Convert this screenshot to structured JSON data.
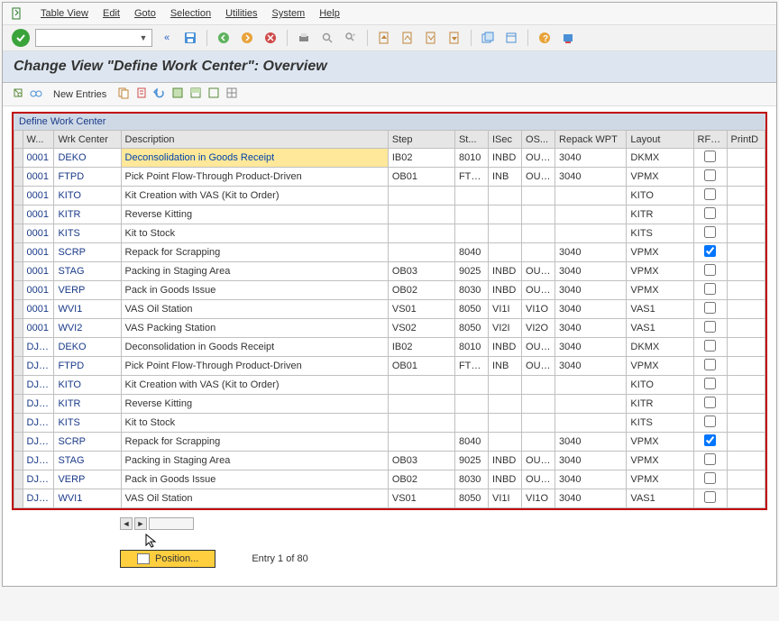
{
  "menubar": {
    "items": [
      "Table View",
      "Edit",
      "Goto",
      "Selection",
      "Utilities",
      "System",
      "Help"
    ]
  },
  "heading": "Change View \"Define Work Center\": Overview",
  "subToolbar": {
    "newEntries": "New Entries"
  },
  "table": {
    "title": "Define Work Center",
    "headers": {
      "whno": "W...",
      "wrkCenter": "Wrk Center",
      "description": "Description",
      "step": "Step",
      "stor": "St...",
      "isec": "ISec",
      "osec": "OS...",
      "repack": "Repack WPT",
      "layout": "Layout",
      "rfhu": "RF: HU",
      "printd": "PrintD"
    },
    "rows": [
      {
        "whno": "0001",
        "wc": "DEKO",
        "desc": "Deconsolidation in Goods Receipt",
        "step": "IB02",
        "stor": "8010",
        "isec": "INBD",
        "osec": "OUTB",
        "rwpt": "3040",
        "lay": "DKMX",
        "rfhu": false,
        "selected": true
      },
      {
        "whno": "0001",
        "wc": "FTPD",
        "desc": "Pick Point Flow-Through Product-Driven",
        "step": "OB01",
        "stor": "FTPD",
        "isec": "INB",
        "osec": "OUTB",
        "rwpt": "3040",
        "lay": "VPMX",
        "rfhu": false
      },
      {
        "whno": "0001",
        "wc": "KITO",
        "desc": "Kit Creation with VAS (Kit to Order)",
        "step": "",
        "stor": "",
        "isec": "",
        "osec": "",
        "rwpt": "",
        "lay": "KITO",
        "rfhu": false
      },
      {
        "whno": "0001",
        "wc": "KITR",
        "desc": "Reverse Kitting",
        "step": "",
        "stor": "",
        "isec": "",
        "osec": "",
        "rwpt": "",
        "lay": "KITR",
        "rfhu": false
      },
      {
        "whno": "0001",
        "wc": "KITS",
        "desc": "Kit to Stock",
        "step": "",
        "stor": "",
        "isec": "",
        "osec": "",
        "rwpt": "",
        "lay": "KITS",
        "rfhu": false
      },
      {
        "whno": "0001",
        "wc": "SCRP",
        "desc": "Repack for Scrapping",
        "step": "",
        "stor": "8040",
        "isec": "",
        "osec": "",
        "rwpt": "3040",
        "lay": "VPMX",
        "rfhu": true
      },
      {
        "whno": "0001",
        "wc": "STAG",
        "desc": "Packing in Staging Area",
        "step": "OB03",
        "stor": "9025",
        "isec": "INBD",
        "osec": "OUTB",
        "rwpt": "3040",
        "lay": "VPMX",
        "rfhu": false
      },
      {
        "whno": "0001",
        "wc": "VERP",
        "desc": "Pack in Goods Issue",
        "step": "OB02",
        "stor": "8030",
        "isec": "INBD",
        "osec": "OUTB",
        "rwpt": "3040",
        "lay": "VPMX",
        "rfhu": false
      },
      {
        "whno": "0001",
        "wc": "WVI1",
        "desc": "VAS Oil Station",
        "step": "VS01",
        "stor": "8050",
        "isec": "VI1I",
        "osec": "VI1O",
        "rwpt": "3040",
        "lay": "VAS1",
        "rfhu": false
      },
      {
        "whno": "0001",
        "wc": "WVI2",
        "desc": "VAS Packing Station",
        "step": "VS02",
        "stor": "8050",
        "isec": "VI2I",
        "osec": "VI2O",
        "rwpt": "3040",
        "lay": "VAS1",
        "rfhu": false
      },
      {
        "whno": "DJPL",
        "wc": "DEKO",
        "desc": "Deconsolidation in Goods Receipt",
        "step": "IB02",
        "stor": "8010",
        "isec": "INBD",
        "osec": "OUTB",
        "rwpt": "3040",
        "lay": "DKMX",
        "rfhu": false
      },
      {
        "whno": "DJPL",
        "wc": "FTPD",
        "desc": "Pick Point Flow-Through Product-Driven",
        "step": "OB01",
        "stor": "FTPD",
        "isec": "INB",
        "osec": "OUTB",
        "rwpt": "3040",
        "lay": "VPMX",
        "rfhu": false
      },
      {
        "whno": "DJPL",
        "wc": "KITO",
        "desc": "Kit Creation with VAS (Kit to Order)",
        "step": "",
        "stor": "",
        "isec": "",
        "osec": "",
        "rwpt": "",
        "lay": "KITO",
        "rfhu": false
      },
      {
        "whno": "DJPL",
        "wc": "KITR",
        "desc": "Reverse Kitting",
        "step": "",
        "stor": "",
        "isec": "",
        "osec": "",
        "rwpt": "",
        "lay": "KITR",
        "rfhu": false
      },
      {
        "whno": "DJPL",
        "wc": "KITS",
        "desc": "Kit to Stock",
        "step": "",
        "stor": "",
        "isec": "",
        "osec": "",
        "rwpt": "",
        "lay": "KITS",
        "rfhu": false
      },
      {
        "whno": "DJPL",
        "wc": "SCRP",
        "desc": "Repack for Scrapping",
        "step": "",
        "stor": "8040",
        "isec": "",
        "osec": "",
        "rwpt": "3040",
        "lay": "VPMX",
        "rfhu": true
      },
      {
        "whno": "DJPL",
        "wc": "STAG",
        "desc": "Packing in Staging Area",
        "step": "OB03",
        "stor": "9025",
        "isec": "INBD",
        "osec": "OUTB",
        "rwpt": "3040",
        "lay": "VPMX",
        "rfhu": false
      },
      {
        "whno": "DJPL",
        "wc": "VERP",
        "desc": "Pack in Goods Issue",
        "step": "OB02",
        "stor": "8030",
        "isec": "INBD",
        "osec": "OUTB",
        "rwpt": "3040",
        "lay": "VPMX",
        "rfhu": false
      },
      {
        "whno": "DJPL",
        "wc": "WVI1",
        "desc": "VAS Oil Station",
        "step": "VS01",
        "stor": "8050",
        "isec": "VI1I",
        "osec": "VI1O",
        "rwpt": "3040",
        "lay": "VAS1",
        "rfhu": false
      }
    ]
  },
  "positionBtn": "Position...",
  "entryText": "Entry 1 of 80"
}
